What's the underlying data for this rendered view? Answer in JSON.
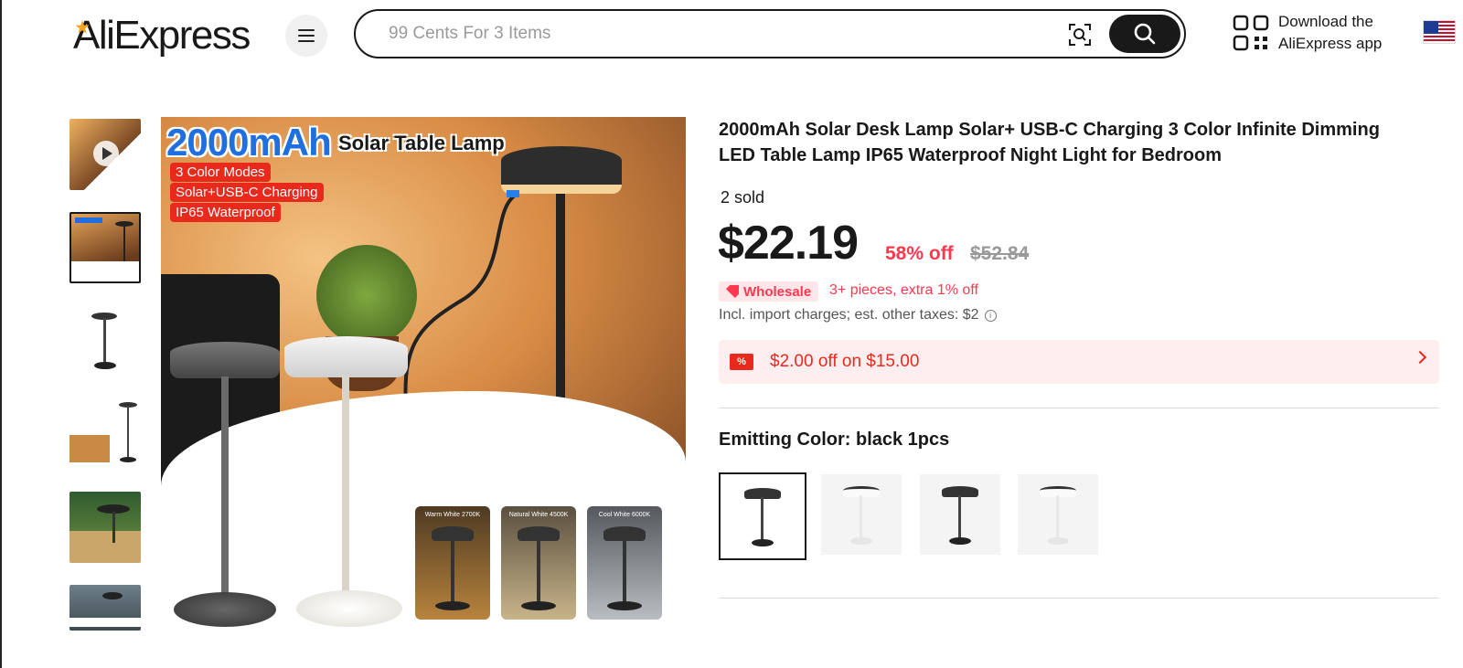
{
  "header": {
    "logo_text": "AliExpress",
    "search_placeholder": "99 Cents For 3 Items",
    "download_line1": "Download the",
    "download_line2": "AliExpress app",
    "flag_partial": "A U",
    "icons": [
      "menu-icon",
      "image-search-icon",
      "search-icon",
      "qr-code-icon",
      "us-flag-icon"
    ]
  },
  "gallery": {
    "thumbnail_count": 6,
    "selected_index": 1,
    "main_image": {
      "headline": "2000mAh",
      "subtitle": "Solar Table Lamp",
      "tags": [
        "3 Color Modes",
        "Solar+USB-C Charging",
        "IP65 Waterproof"
      ],
      "color_modes": [
        "Warm White 2700K",
        "Natural White 4500K",
        "Cool White 6000K"
      ]
    }
  },
  "product": {
    "title": "2000mAh Solar Desk Lamp Solar+ USB-C Charging 3 Color Infinite Dimming LED Table Lamp IP65 Waterproof Night Light for Bedroom",
    "sold": "2 sold",
    "price": "$22.19",
    "discount": "58% off",
    "original_price": "$52.84",
    "wholesale_label": "Wholesale",
    "wholesale_offer": "3+ pieces, extra 1% off",
    "tax_note": "Incl. import charges; est. other taxes: $2",
    "coupon": "$2.00 off on $15.00",
    "coupon_icon": "%",
    "color_label": "Emitting Color: black 1pcs",
    "swatches": [
      "black",
      "white",
      "black",
      "white"
    ],
    "accent_color": "#fd384f"
  }
}
